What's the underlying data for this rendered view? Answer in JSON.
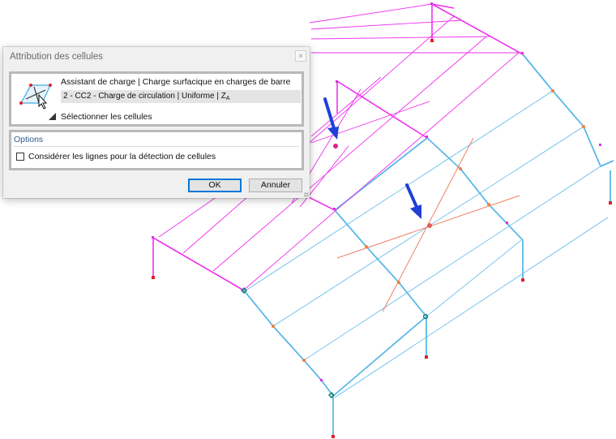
{
  "dialog": {
    "title": "Attribution des cellules",
    "close_symbol": "×",
    "assistant_title": "Assistant de charge | Charge surfacique en charges de barre",
    "load_value": "2 - CC2 - Charge de circulation | Uniforme | Z",
    "load_value_subscript": "A",
    "select_cells_label": "Sélectionner les cellules",
    "options_title": "Options",
    "consider_lines_label": "Considérer les lignes pour la détection de cellules",
    "consider_lines_checked": false,
    "ok_label": "OK",
    "cancel_label": "Annuler",
    "icon": "cell-wizard-icon"
  },
  "colors": {
    "magenta_members": "#ee30ee",
    "cyan_members": "#5bb8e8",
    "orange_lines": "#f08060",
    "support_red": "#e0202a",
    "arrow_blue": "#1f3fd6",
    "options_blue": "#2c5d8e"
  },
  "viewport": {
    "content": "3D frame structure with roof cells",
    "annotation_arrows": [
      "blue-arrow-icon",
      "blue-arrow-icon"
    ]
  }
}
